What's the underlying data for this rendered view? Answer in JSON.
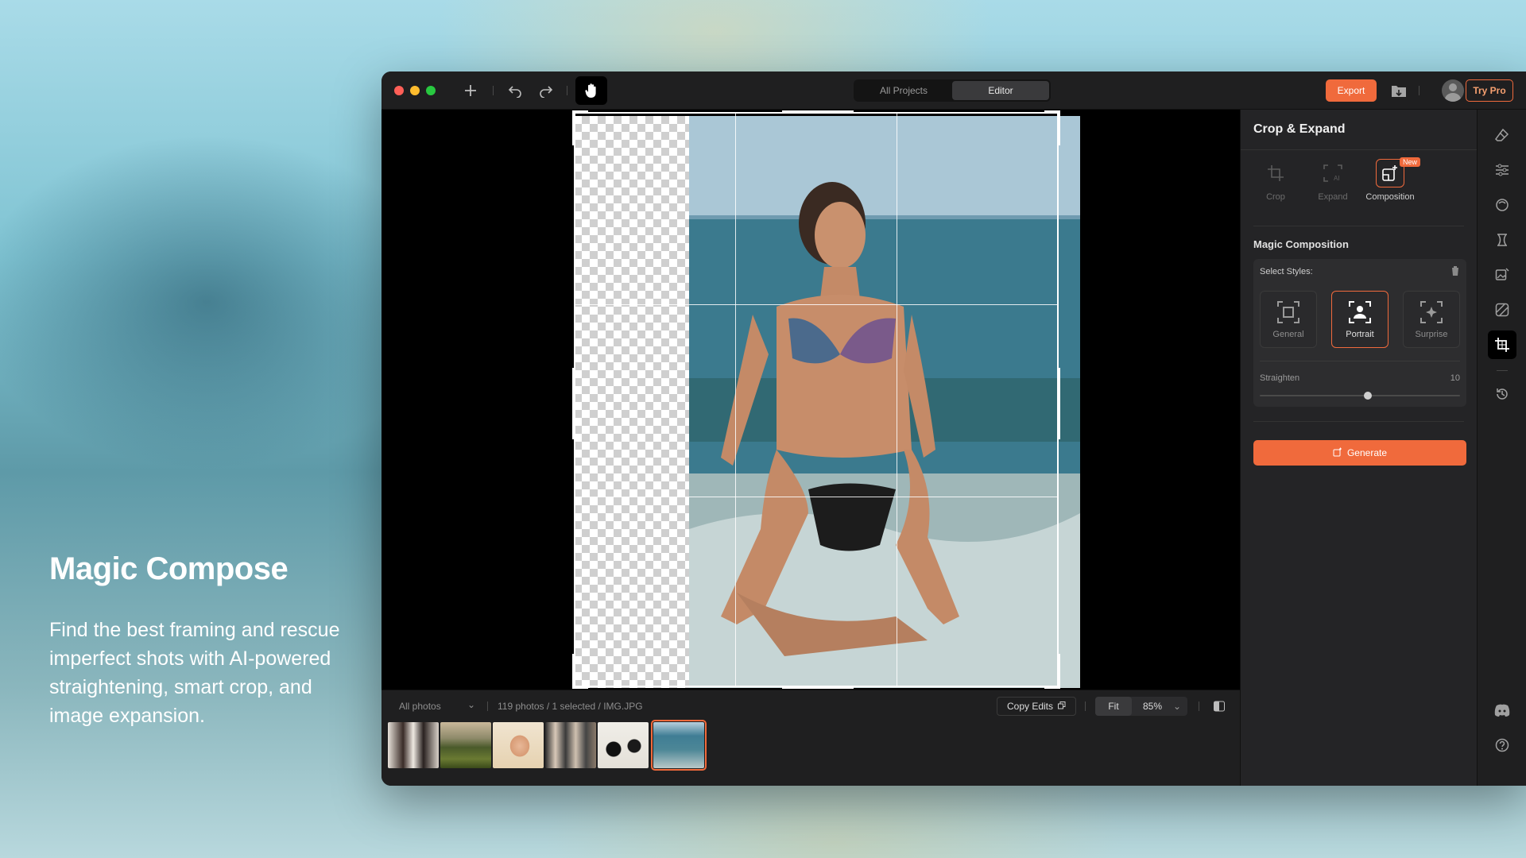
{
  "promo": {
    "title": "Magic Compose",
    "description": "Find the best framing and rescue imperfect shots with AI-powered straightening, smart crop, and image expansion."
  },
  "titlebar": {
    "tabs": [
      "All Projects",
      "Editor"
    ],
    "active_tab": "Editor",
    "export_label": "Export",
    "try_pro_label": "Try Pro"
  },
  "panel": {
    "title": "Crop & Expand",
    "modes": [
      {
        "label": "Crop",
        "icon": "crop-icon"
      },
      {
        "label": "Expand",
        "icon": "expand-ai-icon"
      },
      {
        "label": "Composition",
        "icon": "composition-icon"
      }
    ],
    "active_mode": "Composition",
    "new_badge": "New",
    "section_title": "Magic Composition",
    "select_styles_label": "Select Styles:",
    "styles": [
      {
        "label": "General",
        "icon": "general-frame-icon"
      },
      {
        "label": "Portrait",
        "icon": "portrait-frame-icon"
      },
      {
        "label": "Surprise",
        "icon": "surprise-frame-icon"
      }
    ],
    "active_style": "Portrait",
    "straighten_label": "Straighten",
    "straighten_value": "10",
    "straighten_fraction": 0.54,
    "generate_label": "Generate"
  },
  "bottombar": {
    "filter_label": "All photos",
    "status": "119 photos / 1 selected / IMG.JPG",
    "copy_edits_label": "Copy Edits",
    "fit_label": "Fit",
    "zoom_value": "85%"
  },
  "colors": {
    "accent": "#f06a3c",
    "panel_bg": "#242426",
    "window_bg": "#1c1c1d"
  }
}
